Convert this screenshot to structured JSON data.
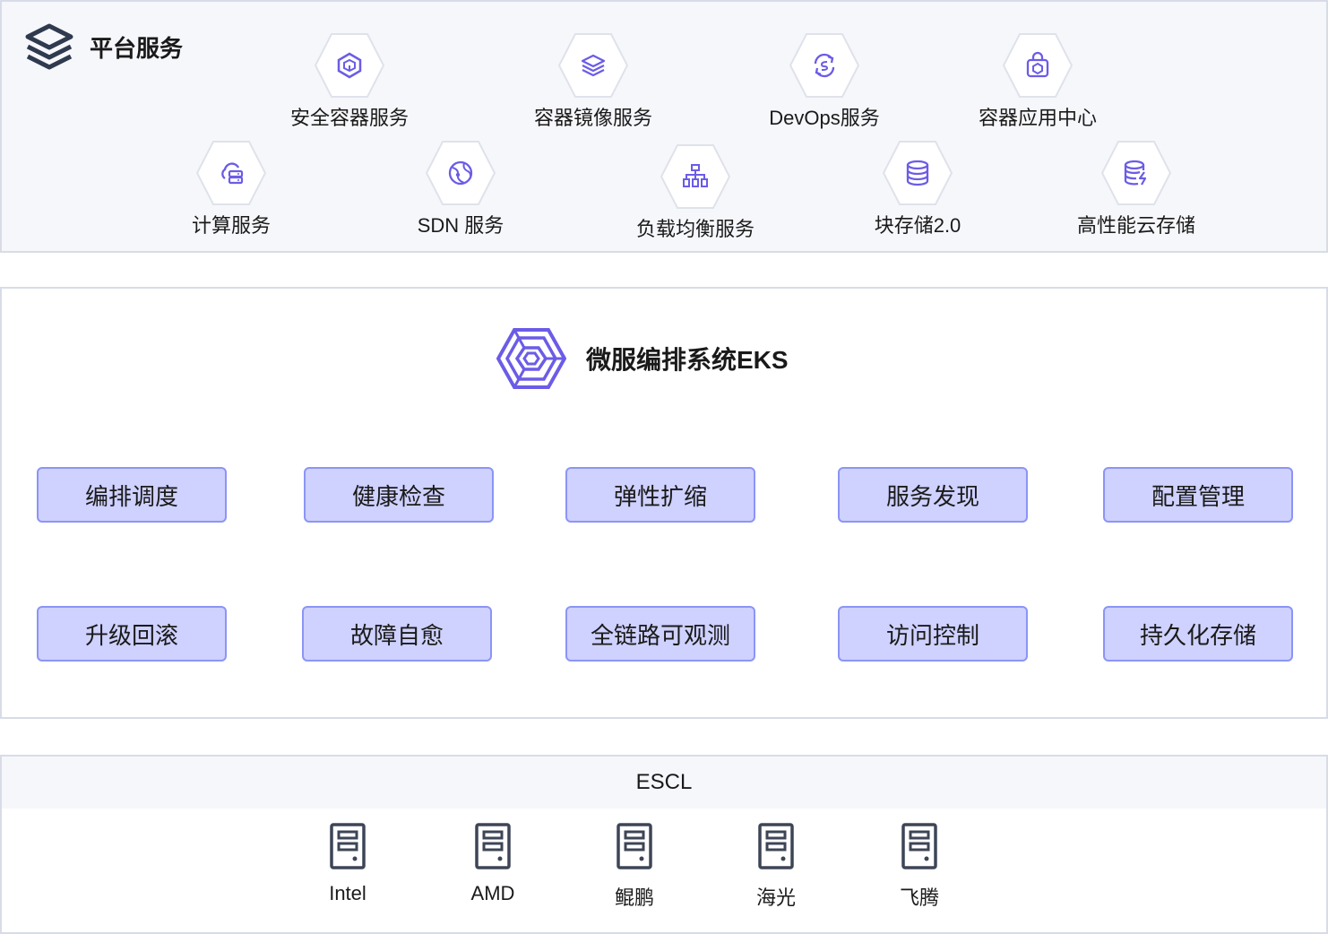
{
  "platform": {
    "title": "平台服务",
    "title_icon": "layers-stack-icon",
    "services_row1": [
      {
        "name": "安全容器服务",
        "icon": "secure-box-icon"
      },
      {
        "name": "容器镜像服务",
        "icon": "layers-image-icon"
      },
      {
        "name": "DevOps服务",
        "icon": "devops-cycle-icon"
      },
      {
        "name": "容器应用中心",
        "icon": "app-bag-icon"
      }
    ],
    "services_row2": [
      {
        "name": "计算服务",
        "icon": "cloud-server-icon"
      },
      {
        "name": "SDN 服务",
        "icon": "network-globe-icon"
      },
      {
        "name": "负载均衡服务",
        "icon": "load-balancer-tree-icon"
      },
      {
        "name": "块存储2.0",
        "icon": "database-icon"
      },
      {
        "name": "高性能云存储",
        "icon": "database-bolt-icon"
      }
    ]
  },
  "eks": {
    "title": "微服编排系统EKS",
    "logo_icon": "eks-hexagon-logo-icon",
    "features_row1": [
      "编排调度",
      "健康检查",
      "弹性扩缩",
      "服务发现",
      "配置管理"
    ],
    "features_row2": [
      "升级回滚",
      "故障自愈",
      "全链路可观测",
      "访问控制",
      "持久化存储"
    ]
  },
  "escl": {
    "title": "ESCL",
    "hardware": [
      {
        "name": "Intel",
        "icon": "server-icon"
      },
      {
        "name": "AMD",
        "icon": "server-icon"
      },
      {
        "name": "鲲鹏",
        "icon": "server-icon"
      },
      {
        "name": "海光",
        "icon": "server-icon"
      },
      {
        "name": "飞腾",
        "icon": "server-icon"
      }
    ]
  },
  "colors": {
    "accent": "#6b5ce7",
    "feature_fill": "#cfd1ff",
    "feature_border": "#8b95f5",
    "section_bg": "#f6f7fb",
    "section_border": "#d7dce6"
  }
}
